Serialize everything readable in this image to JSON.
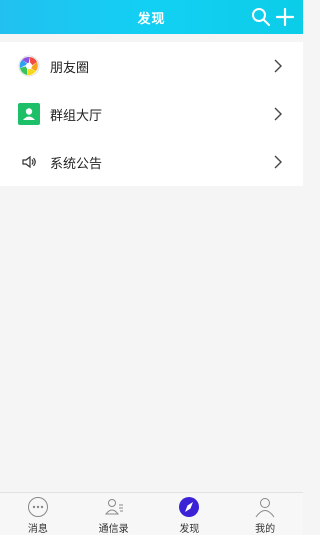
{
  "header": {
    "title": "发现"
  },
  "items": [
    {
      "label": "朋友圈",
      "icon": "moments-aperture-icon"
    },
    {
      "label": "群组大厅",
      "icon": "group-hall-icon"
    },
    {
      "label": "系统公告",
      "icon": "speaker-icon"
    }
  ],
  "tabs": [
    {
      "label": "消息",
      "icon": "chat-bubble-icon"
    },
    {
      "label": "通信录",
      "icon": "contacts-icon"
    },
    {
      "label": "发现",
      "icon": "compass-icon"
    },
    {
      "label": "我的",
      "icon": "person-icon"
    }
  ],
  "colors": {
    "header": "#16c8f2",
    "active_tab": "#3b22d6",
    "group_icon": "#1dbf68"
  }
}
